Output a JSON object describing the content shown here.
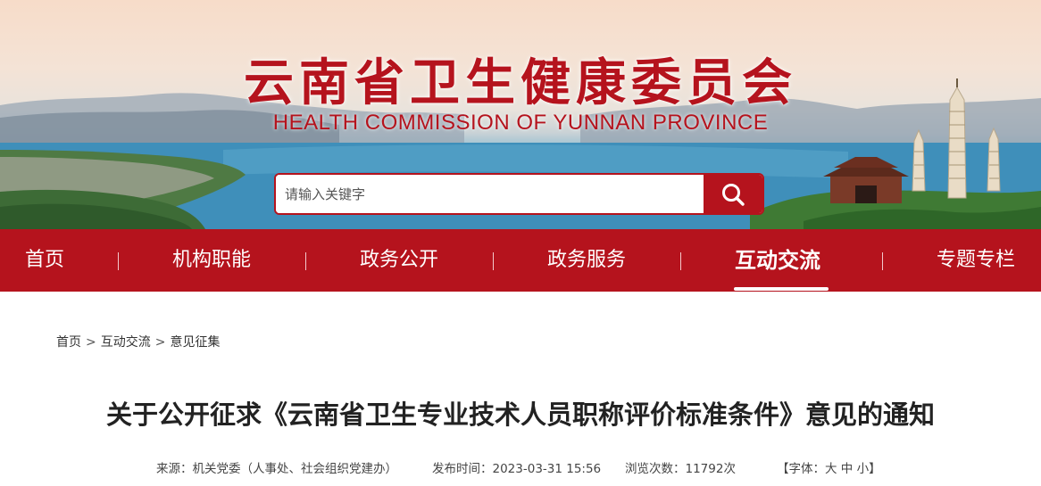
{
  "header": {
    "title": "云南省卫生健康委员会",
    "subtitle": "HEALTH COMMISSION OF YUNNAN PROVINCE"
  },
  "search": {
    "placeholder": "请输入关键字",
    "value": ""
  },
  "nav": {
    "items": [
      {
        "label": "首页"
      },
      {
        "label": "机构职能"
      },
      {
        "label": "政务公开"
      },
      {
        "label": "政务服务"
      },
      {
        "label": "互动交流",
        "active": true
      },
      {
        "label": "专题专栏"
      }
    ]
  },
  "breadcrumb": {
    "items": [
      "首页",
      "互动交流",
      "意见征集"
    ],
    "separator": ">"
  },
  "article": {
    "title": "关于公开征求《云南省卫生专业技术人员职称评价标准条件》意见的通知",
    "source": "来源：机关党委（人事处、社会组织党建办）",
    "publish_time": "发布时间：2023-03-31 15:56",
    "views": "浏览次数：11792次",
    "font_size": {
      "prefix": "【字体：",
      "large": "大",
      "medium": "中",
      "small": "小",
      "suffix": "】"
    }
  },
  "colors": {
    "brand_red": "#b5131d",
    "text": "#222222"
  },
  "icons": {
    "search": "search-icon"
  }
}
